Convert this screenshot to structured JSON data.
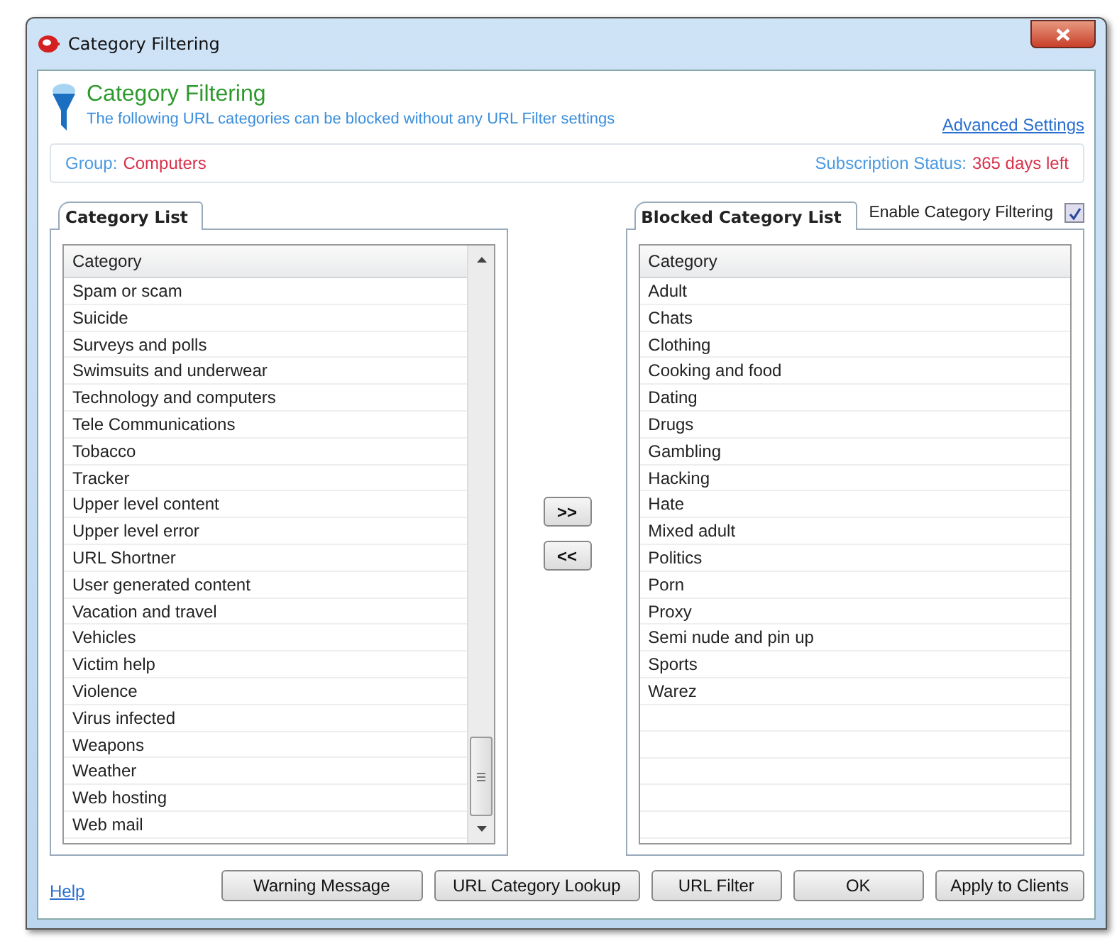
{
  "window": {
    "title": "Category Filtering"
  },
  "header": {
    "title": "Category Filtering",
    "subtitle": "The following URL categories can be blocked without any URL Filter settings",
    "link": "Advanced Settings"
  },
  "info": {
    "group_label": "Group:",
    "group": "Computers",
    "subscription_label": "Subscription Status:",
    "subscription": "365 days left"
  },
  "category_list": {
    "tab": "Category List",
    "column": "Category",
    "rows": [
      "Spam or scam",
      "Suicide",
      "Surveys and polls",
      "Swimsuits and underwear",
      "Technology and computers",
      "Tele Communications",
      "Tobacco",
      "Tracker",
      "Upper level content",
      "Upper level error",
      "URL Shortner",
      "User generated content",
      "Vacation and travel",
      "Vehicles",
      "Victim help",
      "Violence",
      "Virus infected",
      "Weapons",
      "Weather",
      "Web hosting",
      "Web mail"
    ]
  },
  "move_buttons": [
    ">>",
    "<<"
  ],
  "blocked_list": {
    "tab": "Blocked Category List",
    "column": "Category",
    "rows": [
      "Adult",
      "Chats",
      "Clothing",
      "Cooking and food",
      "Dating",
      "Drugs",
      "Gambling",
      "Hacking",
      "Hate",
      "Mixed adult",
      "Politics",
      "Porn",
      "Proxy",
      "Semi nude and pin up",
      "Sports",
      "Warez"
    ]
  },
  "enable_filtering": {
    "label": "Enable Category Filtering",
    "checked": true
  },
  "help_link": "Help",
  "buttons": [
    "Warning Message",
    "URL Category Lookup",
    "URL Filter",
    "OK",
    "Apply to Clients"
  ]
}
